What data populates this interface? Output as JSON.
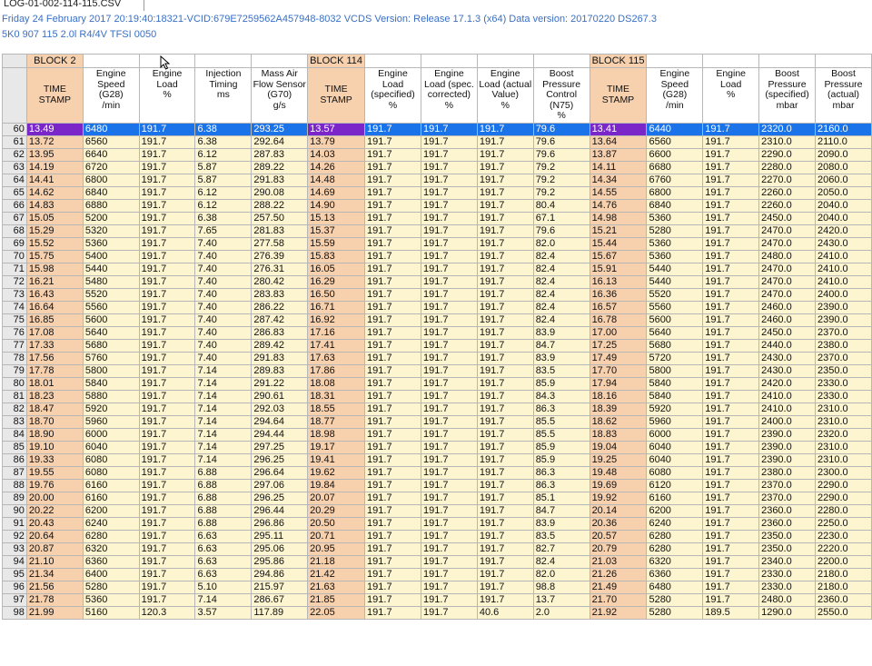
{
  "tab": {
    "label": "LOG-01-002-114-115.CSV"
  },
  "header": {
    "line1": "Friday 24 February 2017 20:19:40:18321-VCID:679E7259562A457948-8032 VCDS Version: Release 17.1.3 (x64) Data version: 20170220 DS267.3",
    "line2": "5K0 907 115  2.0l R4/4V TFSI     0050"
  },
  "blocks": [
    "BLOCK 2",
    "BLOCK 114",
    "BLOCK 115"
  ],
  "columns": [
    {
      "name": "TIME STAMP",
      "unit": "",
      "ts": true
    },
    {
      "name": "Engine Speed (G28)",
      "unit": "/min"
    },
    {
      "name": "Engine Load",
      "unit": "%"
    },
    {
      "name": "Injection Timing",
      "unit": "ms"
    },
    {
      "name": "Mass Air Flow Sensor (G70)",
      "unit": "g/s"
    },
    {
      "name": "TIME STAMP",
      "unit": "",
      "ts": true
    },
    {
      "name": "Engine Load (specified)",
      "unit": "%"
    },
    {
      "name": "Engine Load (spec. corrected)",
      "unit": "%"
    },
    {
      "name": "Engine Load (actual Value)",
      "unit": "%"
    },
    {
      "name": "Boost Pressure Control (N75)",
      "unit": "%"
    },
    {
      "name": "TIME STAMP",
      "unit": "",
      "ts": true
    },
    {
      "name": "Engine Speed (G28)",
      "unit": "/min"
    },
    {
      "name": "Engine Load",
      "unit": "%"
    },
    {
      "name": "Boost Pressure (specified)",
      "unit": "mbar"
    },
    {
      "name": "Boost Pressure (actual)",
      "unit": "mbar"
    }
  ],
  "selected_row": 60,
  "rows": [
    {
      "n": "60",
      "c": [
        "13.49",
        "6480",
        "191.7",
        "6.38",
        "293.25",
        "13.57",
        "191.7",
        "191.7",
        "191.7",
        "79.6",
        "13.41",
        "6440",
        "191.7",
        "2320.0",
        "2160.0"
      ]
    },
    {
      "n": "61",
      "c": [
        "13.72",
        "6560",
        "191.7",
        "6.38",
        "292.64",
        "13.79",
        "191.7",
        "191.7",
        "191.7",
        "79.6",
        "13.64",
        "6560",
        "191.7",
        "2310.0",
        "2110.0"
      ]
    },
    {
      "n": "62",
      "c": [
        "13.95",
        "6640",
        "191.7",
        "6.12",
        "287.83",
        "14.03",
        "191.7",
        "191.7",
        "191.7",
        "79.6",
        "13.87",
        "6600",
        "191.7",
        "2290.0",
        "2090.0"
      ]
    },
    {
      "n": "63",
      "c": [
        "14.19",
        "6720",
        "191.7",
        "5.87",
        "289.22",
        "14.26",
        "191.7",
        "191.7",
        "191.7",
        "79.2",
        "14.11",
        "6680",
        "191.7",
        "2280.0",
        "2080.0"
      ]
    },
    {
      "n": "64",
      "c": [
        "14.41",
        "6800",
        "191.7",
        "5.87",
        "291.83",
        "14.48",
        "191.7",
        "191.7",
        "191.7",
        "79.2",
        "14.34",
        "6760",
        "191.7",
        "2270.0",
        "2060.0"
      ]
    },
    {
      "n": "65",
      "c": [
        "14.62",
        "6840",
        "191.7",
        "6.12",
        "290.08",
        "14.69",
        "191.7",
        "191.7",
        "191.7",
        "79.2",
        "14.55",
        "6800",
        "191.7",
        "2260.0",
        "2050.0"
      ]
    },
    {
      "n": "66",
      "c": [
        "14.83",
        "6880",
        "191.7",
        "6.12",
        "288.22",
        "14.90",
        "191.7",
        "191.7",
        "191.7",
        "80.4",
        "14.76",
        "6840",
        "191.7",
        "2260.0",
        "2040.0"
      ]
    },
    {
      "n": "67",
      "c": [
        "15.05",
        "5200",
        "191.7",
        "6.38",
        "257.50",
        "15.13",
        "191.7",
        "191.7",
        "191.7",
        "67.1",
        "14.98",
        "5360",
        "191.7",
        "2450.0",
        "2040.0"
      ]
    },
    {
      "n": "68",
      "c": [
        "15.29",
        "5320",
        "191.7",
        "7.65",
        "281.83",
        "15.37",
        "191.7",
        "191.7",
        "191.7",
        "79.6",
        "15.21",
        "5280",
        "191.7",
        "2470.0",
        "2420.0"
      ]
    },
    {
      "n": "69",
      "c": [
        "15.52",
        "5360",
        "191.7",
        "7.40",
        "277.58",
        "15.59",
        "191.7",
        "191.7",
        "191.7",
        "82.0",
        "15.44",
        "5360",
        "191.7",
        "2470.0",
        "2430.0"
      ]
    },
    {
      "n": "70",
      "c": [
        "15.75",
        "5400",
        "191.7",
        "7.40",
        "276.39",
        "15.83",
        "191.7",
        "191.7",
        "191.7",
        "82.4",
        "15.67",
        "5360",
        "191.7",
        "2480.0",
        "2410.0"
      ]
    },
    {
      "n": "71",
      "c": [
        "15.98",
        "5440",
        "191.7",
        "7.40",
        "276.31",
        "16.05",
        "191.7",
        "191.7",
        "191.7",
        "82.4",
        "15.91",
        "5440",
        "191.7",
        "2470.0",
        "2410.0"
      ]
    },
    {
      "n": "72",
      "c": [
        "16.21",
        "5480",
        "191.7",
        "7.40",
        "280.42",
        "16.29",
        "191.7",
        "191.7",
        "191.7",
        "82.4",
        "16.13",
        "5440",
        "191.7",
        "2470.0",
        "2410.0"
      ]
    },
    {
      "n": "73",
      "c": [
        "16.43",
        "5520",
        "191.7",
        "7.40",
        "283.83",
        "16.50",
        "191.7",
        "191.7",
        "191.7",
        "82.4",
        "16.36",
        "5520",
        "191.7",
        "2470.0",
        "2400.0"
      ]
    },
    {
      "n": "74",
      "c": [
        "16.64",
        "5560",
        "191.7",
        "7.40",
        "286.22",
        "16.71",
        "191.7",
        "191.7",
        "191.7",
        "82.4",
        "16.57",
        "5560",
        "191.7",
        "2460.0",
        "2390.0"
      ]
    },
    {
      "n": "75",
      "c": [
        "16.85",
        "5600",
        "191.7",
        "7.40",
        "287.42",
        "16.92",
        "191.7",
        "191.7",
        "191.7",
        "82.4",
        "16.78",
        "5600",
        "191.7",
        "2460.0",
        "2390.0"
      ]
    },
    {
      "n": "76",
      "c": [
        "17.08",
        "5640",
        "191.7",
        "7.40",
        "286.83",
        "17.16",
        "191.7",
        "191.7",
        "191.7",
        "83.9",
        "17.00",
        "5640",
        "191.7",
        "2450.0",
        "2370.0"
      ]
    },
    {
      "n": "77",
      "c": [
        "17.33",
        "5680",
        "191.7",
        "7.40",
        "289.42",
        "17.41",
        "191.7",
        "191.7",
        "191.7",
        "84.7",
        "17.25",
        "5680",
        "191.7",
        "2440.0",
        "2380.0"
      ]
    },
    {
      "n": "78",
      "c": [
        "17.56",
        "5760",
        "191.7",
        "7.40",
        "291.83",
        "17.63",
        "191.7",
        "191.7",
        "191.7",
        "83.9",
        "17.49",
        "5720",
        "191.7",
        "2430.0",
        "2370.0"
      ]
    },
    {
      "n": "79",
      "c": [
        "17.78",
        "5800",
        "191.7",
        "7.14",
        "289.83",
        "17.86",
        "191.7",
        "191.7",
        "191.7",
        "83.5",
        "17.70",
        "5800",
        "191.7",
        "2430.0",
        "2350.0"
      ]
    },
    {
      "n": "80",
      "c": [
        "18.01",
        "5840",
        "191.7",
        "7.14",
        "291.22",
        "18.08",
        "191.7",
        "191.7",
        "191.7",
        "85.9",
        "17.94",
        "5840",
        "191.7",
        "2420.0",
        "2330.0"
      ]
    },
    {
      "n": "81",
      "c": [
        "18.23",
        "5880",
        "191.7",
        "7.14",
        "290.61",
        "18.31",
        "191.7",
        "191.7",
        "191.7",
        "84.3",
        "18.16",
        "5840",
        "191.7",
        "2410.0",
        "2330.0"
      ]
    },
    {
      "n": "82",
      "c": [
        "18.47",
        "5920",
        "191.7",
        "7.14",
        "292.03",
        "18.55",
        "191.7",
        "191.7",
        "191.7",
        "86.3",
        "18.39",
        "5920",
        "191.7",
        "2410.0",
        "2310.0"
      ]
    },
    {
      "n": "83",
      "c": [
        "18.70",
        "5960",
        "191.7",
        "7.14",
        "294.64",
        "18.77",
        "191.7",
        "191.7",
        "191.7",
        "85.5",
        "18.62",
        "5960",
        "191.7",
        "2400.0",
        "2310.0"
      ]
    },
    {
      "n": "84",
      "c": [
        "18.90",
        "6000",
        "191.7",
        "7.14",
        "294.44",
        "18.98",
        "191.7",
        "191.7",
        "191.7",
        "85.5",
        "18.83",
        "6000",
        "191.7",
        "2390.0",
        "2320.0"
      ]
    },
    {
      "n": "85",
      "c": [
        "19.10",
        "6040",
        "191.7",
        "7.14",
        "297.25",
        "19.17",
        "191.7",
        "191.7",
        "191.7",
        "85.9",
        "19.04",
        "6040",
        "191.7",
        "2390.0",
        "2310.0"
      ]
    },
    {
      "n": "86",
      "c": [
        "19.33",
        "6080",
        "191.7",
        "7.14",
        "296.25",
        "19.41",
        "191.7",
        "191.7",
        "191.7",
        "85.9",
        "19.25",
        "6040",
        "191.7",
        "2390.0",
        "2310.0"
      ]
    },
    {
      "n": "87",
      "c": [
        "19.55",
        "6080",
        "191.7",
        "6.88",
        "296.64",
        "19.62",
        "191.7",
        "191.7",
        "191.7",
        "86.3",
        "19.48",
        "6080",
        "191.7",
        "2380.0",
        "2300.0"
      ]
    },
    {
      "n": "88",
      "c": [
        "19.76",
        "6160",
        "191.7",
        "6.88",
        "297.06",
        "19.84",
        "191.7",
        "191.7",
        "191.7",
        "86.3",
        "19.69",
        "6120",
        "191.7",
        "2370.0",
        "2290.0"
      ]
    },
    {
      "n": "89",
      "c": [
        "20.00",
        "6160",
        "191.7",
        "6.88",
        "296.25",
        "20.07",
        "191.7",
        "191.7",
        "191.7",
        "85.1",
        "19.92",
        "6160",
        "191.7",
        "2370.0",
        "2290.0"
      ]
    },
    {
      "n": "90",
      "c": [
        "20.22",
        "6200",
        "191.7",
        "6.88",
        "296.44",
        "20.29",
        "191.7",
        "191.7",
        "191.7",
        "84.7",
        "20.14",
        "6200",
        "191.7",
        "2360.0",
        "2280.0"
      ]
    },
    {
      "n": "91",
      "c": [
        "20.43",
        "6240",
        "191.7",
        "6.88",
        "296.86",
        "20.50",
        "191.7",
        "191.7",
        "191.7",
        "83.9",
        "20.36",
        "6240",
        "191.7",
        "2360.0",
        "2250.0"
      ]
    },
    {
      "n": "92",
      "c": [
        "20.64",
        "6280",
        "191.7",
        "6.63",
        "295.11",
        "20.71",
        "191.7",
        "191.7",
        "191.7",
        "83.5",
        "20.57",
        "6280",
        "191.7",
        "2350.0",
        "2230.0"
      ]
    },
    {
      "n": "93",
      "c": [
        "20.87",
        "6320",
        "191.7",
        "6.63",
        "295.06",
        "20.95",
        "191.7",
        "191.7",
        "191.7",
        "82.7",
        "20.79",
        "6280",
        "191.7",
        "2350.0",
        "2220.0"
      ]
    },
    {
      "n": "94",
      "c": [
        "21.10",
        "6360",
        "191.7",
        "6.63",
        "295.86",
        "21.18",
        "191.7",
        "191.7",
        "191.7",
        "82.4",
        "21.03",
        "6320",
        "191.7",
        "2340.0",
        "2200.0"
      ]
    },
    {
      "n": "95",
      "c": [
        "21.34",
        "6400",
        "191.7",
        "6.63",
        "294.86",
        "21.42",
        "191.7",
        "191.7",
        "191.7",
        "82.0",
        "21.26",
        "6360",
        "191.7",
        "2330.0",
        "2180.0"
      ]
    },
    {
      "n": "96",
      "c": [
        "21.56",
        "5280",
        "191.7",
        "5.10",
        "215.97",
        "21.63",
        "191.7",
        "191.7",
        "191.7",
        "98.8",
        "21.49",
        "6480",
        "191.7",
        "2330.0",
        "2180.0"
      ]
    },
    {
      "n": "97",
      "c": [
        "21.78",
        "5360",
        "191.7",
        "7.14",
        "286.67",
        "21.85",
        "191.7",
        "191.7",
        "191.7",
        "13.7",
        "21.70",
        "5280",
        "191.7",
        "2480.0",
        "2360.0"
      ]
    },
    {
      "n": "98",
      "c": [
        "21.99",
        "5160",
        "120.3",
        "3.57",
        "117.89",
        "22.05",
        "191.7",
        "191.7",
        "40.6",
        "2.0",
        "21.92",
        "5280",
        "189.5",
        "1290.0",
        "2550.0"
      ]
    }
  ],
  "colors": {
    "timestamp_bg": "#f7d0ae",
    "data_bg": "#fdf5cf",
    "selection_bg": "#1a73e8",
    "selection_ts_bg": "#7b26c9",
    "header_text": "#3a6fc4"
  }
}
